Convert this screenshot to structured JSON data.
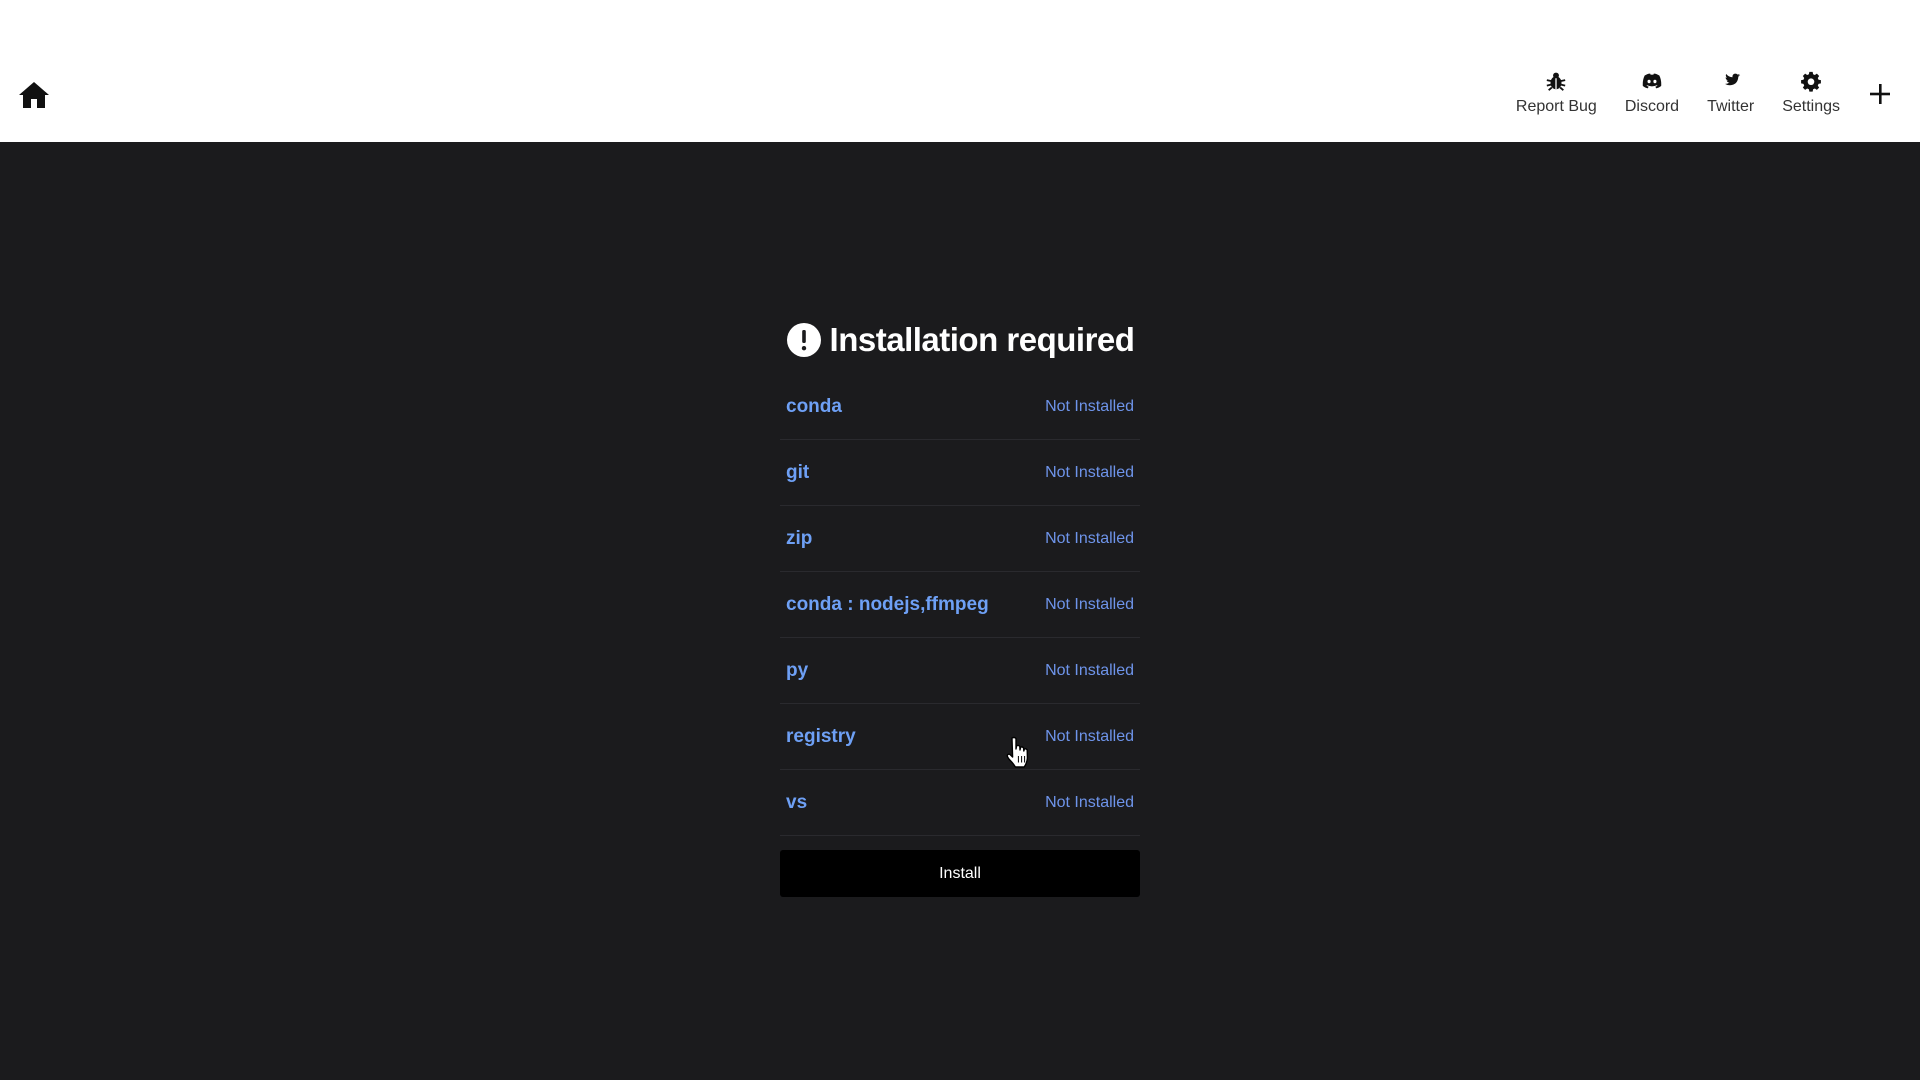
{
  "topbar": {
    "nav": [
      {
        "name": "report-bug",
        "label": "Report Bug",
        "icon": "bug-icon"
      },
      {
        "name": "discord",
        "label": "Discord",
        "icon": "discord-icon"
      },
      {
        "name": "twitter",
        "label": "Twitter",
        "icon": "twitter-icon"
      },
      {
        "name": "settings",
        "label": "Settings",
        "icon": "gear-icon"
      }
    ],
    "home_icon": "home-icon",
    "plus_icon": "plus-icon"
  },
  "panel": {
    "title": "Installation required",
    "title_icon": "exclamation-circle-icon",
    "requirements": [
      {
        "name": "conda",
        "status": "Not Installed"
      },
      {
        "name": "git",
        "status": "Not Installed"
      },
      {
        "name": "zip",
        "status": "Not Installed"
      },
      {
        "name": "conda : nodejs,ffmpeg",
        "status": "Not Installed"
      },
      {
        "name": "py",
        "status": "Not Installed"
      },
      {
        "name": "registry",
        "status": "Not Installed"
      },
      {
        "name": "vs",
        "status": "Not Installed"
      }
    ],
    "install_label": "Install"
  },
  "colors": {
    "background": "#1b1b1d",
    "topbar": "#ffffff",
    "requirement_name": "#6ea0f5",
    "status": "#6e94ea",
    "button": "#000000"
  }
}
